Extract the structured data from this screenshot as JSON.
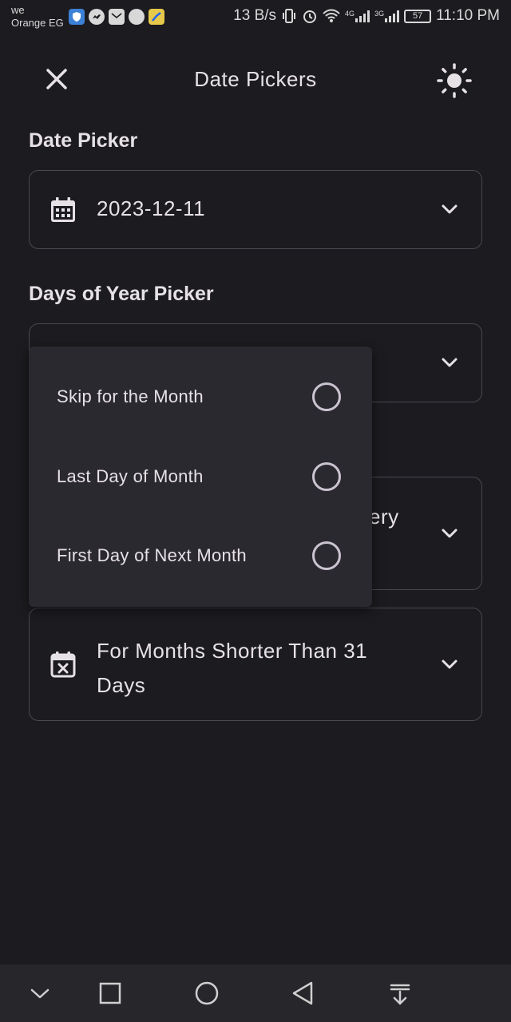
{
  "status_bar": {
    "carrier_line1": "we",
    "carrier_line2": "Orange EG",
    "net_speed": "13 B/s",
    "battery": "57",
    "time": "11:10 PM",
    "signal1_label": "4G",
    "signal2_label": "3G"
  },
  "app_bar": {
    "title": "Date Pickers",
    "close_icon": "close-icon",
    "theme_icon": "sun-icon"
  },
  "sections": {
    "date_picker": {
      "title": "Date Picker",
      "value": "2023-12-11",
      "icon": "calendar-icon"
    },
    "days_of_year": {
      "title": "Days of Year Picker"
    },
    "third_field_partial_text": "ery",
    "short_months": {
      "value_line1": "For Months Shorter Than 31",
      "value_line2": "Days",
      "icon": "calendar-x-icon"
    }
  },
  "menu": {
    "items": [
      {
        "label": "Skip for the Month",
        "selected": false
      },
      {
        "label": "Last Day of Month",
        "selected": false
      },
      {
        "label": "First Day of Next Month",
        "selected": false
      }
    ]
  },
  "nav_bar": {
    "icons": [
      "chevron-down-icon",
      "recents-square-icon",
      "home-circle-icon",
      "back-triangle-icon",
      "notification-pull-icon"
    ]
  },
  "colors": {
    "background": "#1c1b1f",
    "menu_surface": "#2b2930",
    "outline": "#4a4850",
    "text": "#e6e1e5"
  }
}
